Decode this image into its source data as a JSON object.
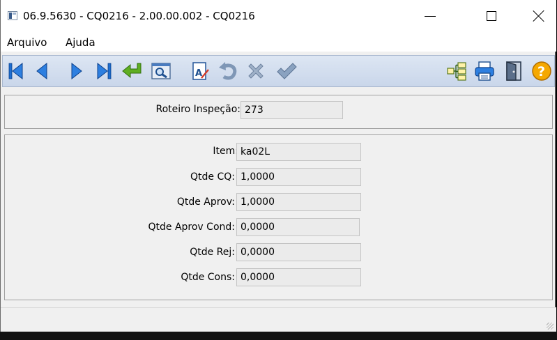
{
  "window": {
    "title": "06.9.5630 - CQ0216 - 2.00.00.002 - CQ0216"
  },
  "menu": {
    "items": [
      "Arquivo",
      "Ajuda"
    ]
  },
  "toolbar": {
    "buttons": [
      {
        "name": "first-record",
        "icon": "first-icon"
      },
      {
        "name": "previous-record",
        "icon": "previous-icon"
      },
      {
        "name": "next-record",
        "icon": "next-icon"
      },
      {
        "name": "last-record",
        "icon": "last-icon"
      },
      {
        "name": "goto",
        "icon": "enter-arrow-icon"
      },
      {
        "name": "search",
        "icon": "search-icon"
      },
      {
        "name": "edit",
        "icon": "edit-document-icon"
      },
      {
        "name": "undo",
        "icon": "undo-icon"
      },
      {
        "name": "cancel",
        "icon": "cancel-x-icon"
      },
      {
        "name": "confirm",
        "icon": "checkmark-icon"
      },
      {
        "name": "tree",
        "icon": "tree-icon"
      },
      {
        "name": "print",
        "icon": "printer-icon"
      },
      {
        "name": "exit",
        "icon": "exit-door-icon"
      },
      {
        "name": "help",
        "icon": "help-icon"
      }
    ],
    "colors": {
      "nav_blue": "#1f6fd1",
      "green": "#4f9a1a",
      "gray": "#8a9fb8",
      "help_orange": "#f0a000"
    }
  },
  "header": {
    "roteiro_label": "Roteiro Inspeção:",
    "roteiro_value": "273"
  },
  "fields": {
    "item_label": "Item:",
    "item_value": "ka02L",
    "qtde_cq_label": "Qtde CQ:",
    "qtde_cq_value": "1,0000",
    "qtde_aprov_label": "Qtde Aprov:",
    "qtde_aprov_value": "1,0000",
    "qtde_aprov_cond_label": "Qtde Aprov Cond:",
    "qtde_aprov_cond_value": "0,0000",
    "qtde_rej_label": "Qtde Rej:",
    "qtde_rej_value": "0,0000",
    "qtde_cons_label": "Qtde Cons:",
    "qtde_cons_value": "0,0000"
  }
}
